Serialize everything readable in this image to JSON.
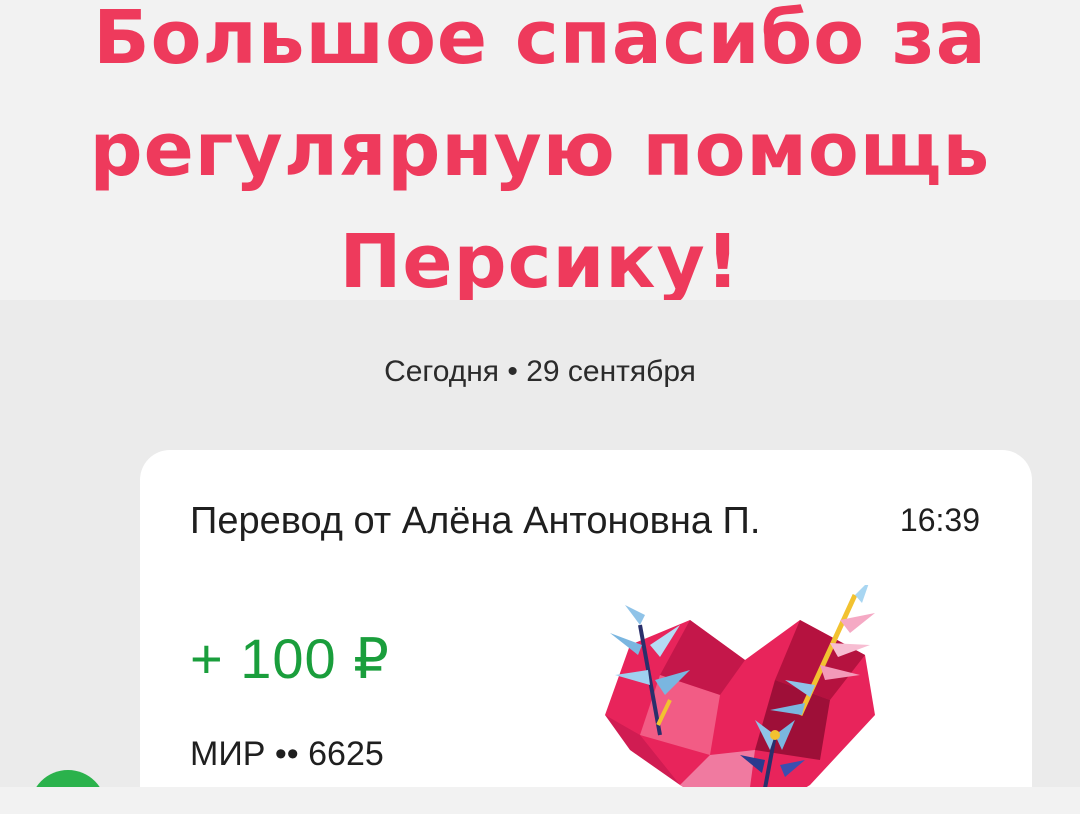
{
  "headline": {
    "line1": "Большое спасибо за",
    "line2": "регулярную помощь",
    "line3": "Персику!"
  },
  "feed": {
    "date_label": "Сегодня • 29 сентября"
  },
  "transaction": {
    "title": "Перевод от Алёна Антоновна П.",
    "time": "16:39",
    "amount": "+ 100 ₽",
    "card": "МИР •• 6625"
  },
  "colors": {
    "headline": "#ee3a5c",
    "amount": "#1a9e3c",
    "avatar": "#2bb24c",
    "heart": "#e8245b"
  },
  "icons": {
    "avatar": "bank-logo-icon",
    "sticker": "heart-with-plants-icon"
  }
}
